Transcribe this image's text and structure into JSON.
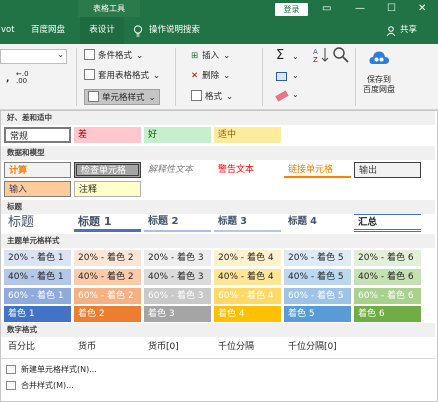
{
  "titlebar": {
    "tools_tab": "表格工具",
    "login": "登录",
    "controls": [
      "▭",
      "—",
      "☐",
      "✕"
    ]
  },
  "tabs": {
    "pivot": "vot",
    "baidu": "百度网盘",
    "design": "表设计",
    "help_search": "操作说明搜索",
    "share": "共享"
  },
  "ribbon": {
    "conditional_format": "条件格式",
    "table_format": "套用表格格式",
    "cell_styles": "单元格样式",
    "insert": "插入",
    "delete": "删除",
    "format": "格式",
    "save_baidu_line1": "保存到",
    "save_baidu_line2": "百度网盘",
    "percent_dec": ".0\n.00"
  },
  "sections": {
    "good_bad": "好、差和适中",
    "data_model": "数据和模型",
    "titles": "标题",
    "themed": "主题单元格样式",
    "number": "数字格式"
  },
  "good_bad": [
    "常规",
    "差",
    "好",
    "适中"
  ],
  "data_model_row1": [
    "计算",
    "检查单元格",
    "解释性文本",
    "警告文本",
    "链接单元格",
    "输出"
  ],
  "data_model_row2": [
    "输入",
    "注释"
  ],
  "titles": [
    "标题",
    "标题 1",
    "标题 2",
    "标题 3",
    "标题 4",
    "汇总"
  ],
  "themed": {
    "row20": [
      "20% - 着色 1",
      "20% - 着色 2",
      "20% - 着色 3",
      "20% - 着色 4",
      "20% - 着色 5",
      "20% - 着色 6"
    ],
    "row40": [
      "40% - 着色 1",
      "40% - 着色 2",
      "40% - 着色 3",
      "40% - 着色 4",
      "40% - 着色 5",
      "40% - 着色 6"
    ],
    "row60": [
      "60% - 着色 1",
      "60% - 着色 2",
      "60% - 着色 3",
      "60% - 着色 4",
      "60% - 着色 5",
      "60% - 着色 6"
    ],
    "rowfull": [
      "着色 1",
      "着色 2",
      "着色 3",
      "着色 4",
      "着色 5",
      "着色 6"
    ]
  },
  "number_formats": [
    "百分比",
    "货币",
    "货币[0]",
    "千位分隔",
    "千位分隔[0]"
  ],
  "menu": {
    "new_style": "新建单元格样式(N)...",
    "merge_styles": "合并样式(M)..."
  },
  "colors": {
    "accent": "#217346",
    "c20": [
      "#dae3f3",
      "#fbe5d6",
      "#ededed",
      "#fff2cc",
      "#deebf7",
      "#e2f0d9"
    ],
    "c40": [
      "#b4c7e7",
      "#f8cbad",
      "#dbdbdb",
      "#ffe699",
      "#bdd7ee",
      "#c5e0b4"
    ],
    "c60": [
      "#8faadc",
      "#f4b183",
      "#c9c9c9",
      "#ffd966",
      "#9dc3e6",
      "#a9d18e"
    ],
    "full": [
      "#4472c4",
      "#ed7d31",
      "#a5a5a5",
      "#ffc000",
      "#5b9bd5",
      "#70ad47"
    ]
  }
}
